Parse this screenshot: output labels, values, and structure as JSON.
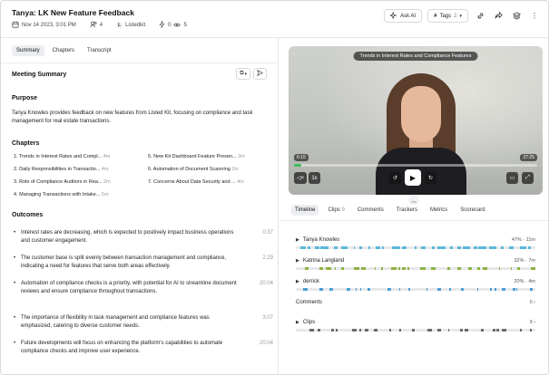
{
  "header": {
    "title": "Tanya: LK New Feature Feedback",
    "date": "Nov 14 2023, 3:01 PM",
    "participants": "4",
    "org_badge": "L",
    "org_name": "Listedkit",
    "likes": "0",
    "views": "5",
    "ask_ai_label": "Ask AI",
    "tags_label": "Tags",
    "tags_count": "2"
  },
  "left_tabs": [
    "Summary",
    "Chapters",
    "Transcript"
  ],
  "summary": {
    "title": "Meeting Summary",
    "purpose_heading": "Purpose",
    "purpose_text": "Tanya Knowles provides feedback on new features from Listed Kit, focusing on compliance and task management for real estate transactions.",
    "chapters_heading": "Chapters",
    "chapters": [
      {
        "label": "1. Trends in Interest Rates and Compl...",
        "dur": "4m"
      },
      {
        "label": "2. Daily Responsibilities in Transactio...",
        "dur": "4m"
      },
      {
        "label": "3. Role of Compliance Auditors in Rea...",
        "dur": "2m"
      },
      {
        "label": "4. Managing Transactions with Intake...",
        "dur": "5m"
      },
      {
        "label": "5. New Kit Dashboard Feature Presen...",
        "dur": "3m"
      },
      {
        "label": "6. Automation of Document Scanning",
        "dur": "2m"
      },
      {
        "label": "7. Concerns About Data Security and ...",
        "dur": "4m"
      }
    ],
    "outcomes_heading": "Outcomes",
    "outcomes": [
      {
        "text": "Interest rates are decreasing, which is expected to positively impact business operations and customer engagement.",
        "ts": "0:37"
      },
      {
        "text": "The customer base is split evenly between transaction management and compliance, indicating a need for features that serve both areas effectively.",
        "ts": "2:29"
      },
      {
        "text": "Automation of compliance checks is a priority, with potential for AI to streamline document reviews and ensure compliance throughout transactions.",
        "ts": "20:04"
      },
      {
        "text": "The importance of flexibility in task management and compliance features was emphasized, catering to diverse customer needs.",
        "ts": "3:07"
      },
      {
        "text": "Future developments will focus on enhancing the platform's capabilities to automate compliance checks and improve user experience.",
        "ts": "20:04"
      }
    ]
  },
  "video": {
    "title": "Trends in Interest Rates and Compliance Features",
    "current_time": "6:15",
    "total_time": "27:25",
    "speed": "1x",
    "progress": 0.03
  },
  "right_tabs": [
    {
      "label": "Timeline",
      "count": ""
    },
    {
      "label": "Clips",
      "count": "9"
    },
    {
      "label": "Comments",
      "count": ""
    },
    {
      "label": "Trackers",
      "count": ""
    },
    {
      "label": "Metrics",
      "count": ""
    },
    {
      "label": "Scorecard",
      "count": ""
    }
  ],
  "timeline": {
    "speakers": [
      {
        "name": "Tanya Knowles",
        "stat": "47% · 11m",
        "color": "#5ab8d9"
      },
      {
        "name": "Katrina Langland",
        "stat": "32% · 7m",
        "color": "#8cb23f"
      },
      {
        "name": "derrick",
        "stat": "20% · 4m",
        "color": "#4a9fd6"
      }
    ],
    "comments_label": "Comments",
    "comments_count": "0",
    "clips_label": "Clips",
    "clips_count": "9",
    "clip_color": "#6b6b6b"
  }
}
